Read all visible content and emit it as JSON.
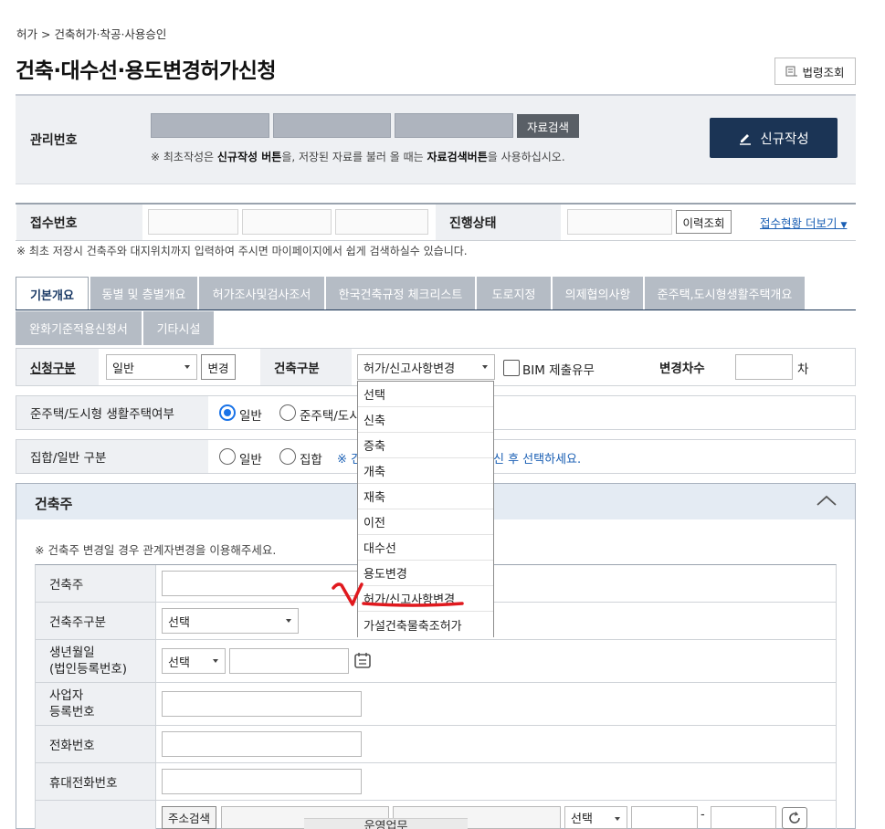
{
  "breadcrumb": {
    "root": "허가",
    "separator": ">",
    "current": "건축허가·착공·사용승인"
  },
  "page": {
    "title": "건축·대수선·용도변경허가신청",
    "law_button": "법령조회"
  },
  "management": {
    "label": "관리번호",
    "search_button": "자료검색",
    "note_prefix": "※ 최초작성은 ",
    "note_bold1": "신규작성 버튼",
    "note_mid": "을, 저장된 자료를 불러 올 때는 ",
    "note_bold2": "자료검색버튼",
    "note_suffix": "을 사용하십시오.",
    "new_button": "신규작성"
  },
  "receipt": {
    "label": "접수번호",
    "status_label": "진행상태",
    "history_button": "이력조회",
    "more_link": "접수현황 더보기",
    "note": "※ 최초 저장시 건축주와 대지위치까지 입력하여 주시면 마이페이지에서 쉽게 검색하실수 있습니다."
  },
  "tabs": [
    {
      "label": "기본개요",
      "active": true
    },
    {
      "label": "동별 및 층별개요"
    },
    {
      "label": "허가조사및검사조서"
    },
    {
      "label": "한국건축규정 체크리스트"
    },
    {
      "label": "도로지정"
    },
    {
      "label": "의제협의사항"
    },
    {
      "label": "준주택,도시형생활주택개요"
    },
    {
      "label": "완화기준적용신청서"
    },
    {
      "label": "기타시설"
    }
  ],
  "application": {
    "type_label": "신청구분",
    "type_value": "일반",
    "change_button": "변경",
    "building_type_label": "건축구분",
    "building_type_value": "허가/신고사항변경",
    "bim_label": "BIM 제출유무",
    "change_count_label": "변경차수",
    "change_count_unit": "차"
  },
  "housing": {
    "label": "준주택/도시형 생활주택여부",
    "option1": "일반",
    "option2": "준주택/도시"
  },
  "collective": {
    "label": "집합/일반 구분",
    "option1": "일반",
    "option2": "집합",
    "note_start": "※ 건",
    "note_end": "신 후 선택하세요."
  },
  "dropdown_options": [
    "선택",
    "신축",
    "증축",
    "개축",
    "재축",
    "이전",
    "대수선",
    "용도변경",
    "허가/신고사항변경",
    "가설건축물축조허가"
  ],
  "builder": {
    "title": "건축주",
    "note": "※ 건축주 변경일 경우 관계자변경을 이용해주세요.",
    "rows": {
      "owner": "건축주",
      "owner_type": "건축주구분",
      "birth_line1": "생년월일",
      "birth_line2": "(법인등록번호)",
      "biz_line1": "사업자",
      "biz_line2": "등록번호",
      "phone": "전화번호",
      "mobile": "휴대전화번호"
    },
    "owner_type_value": "선택",
    "birth_select_value": "선택",
    "address_button": "주소검색",
    "address_select_value": "선택",
    "dash": "-",
    "cutoff_text": "운영업무"
  },
  "colors": {
    "navy": "#1b3455",
    "accent_blue": "#1a73e8",
    "link": "#1a5fb4",
    "red_mark": "#e0191e"
  }
}
